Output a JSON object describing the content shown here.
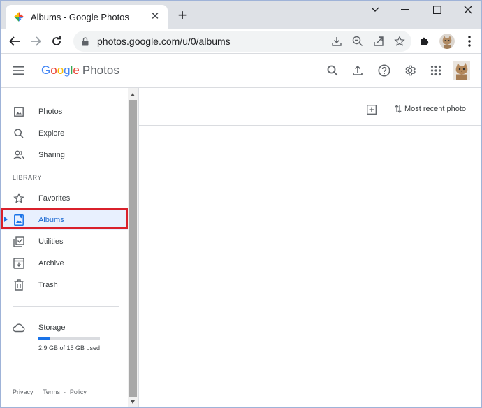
{
  "browser": {
    "tab_title": "Albums - Google Photos",
    "url": "photos.google.com/u/0/albums"
  },
  "header": {
    "logo_parts": [
      "G",
      "o",
      "o",
      "g",
      "l",
      "e"
    ],
    "product_name": "Photos"
  },
  "sidebar": {
    "items_top": [
      {
        "label": "Photos",
        "icon": "photo-icon"
      },
      {
        "label": "Explore",
        "icon": "search-icon"
      },
      {
        "label": "Sharing",
        "icon": "people-icon"
      }
    ],
    "section_label": "LIBRARY",
    "library_items": [
      {
        "label": "Favorites",
        "icon": "star-icon"
      },
      {
        "label": "Albums",
        "icon": "album-icon",
        "active": true
      },
      {
        "label": "Utilities",
        "icon": "utilities-icon"
      },
      {
        "label": "Archive",
        "icon": "archive-icon"
      },
      {
        "label": "Trash",
        "icon": "trash-icon"
      }
    ],
    "storage": {
      "label": "Storage",
      "usage_text": "2.9 GB of 15 GB used",
      "fraction_used": 0.19
    },
    "footer": [
      "Privacy",
      "·",
      "Terms",
      "·",
      "Policy"
    ]
  },
  "main": {
    "sort_label": "Most recent photo"
  },
  "colors": {
    "accent": "#1a73e8",
    "highlight_border": "#d9202b",
    "active_bg": "#e8f0fe"
  }
}
